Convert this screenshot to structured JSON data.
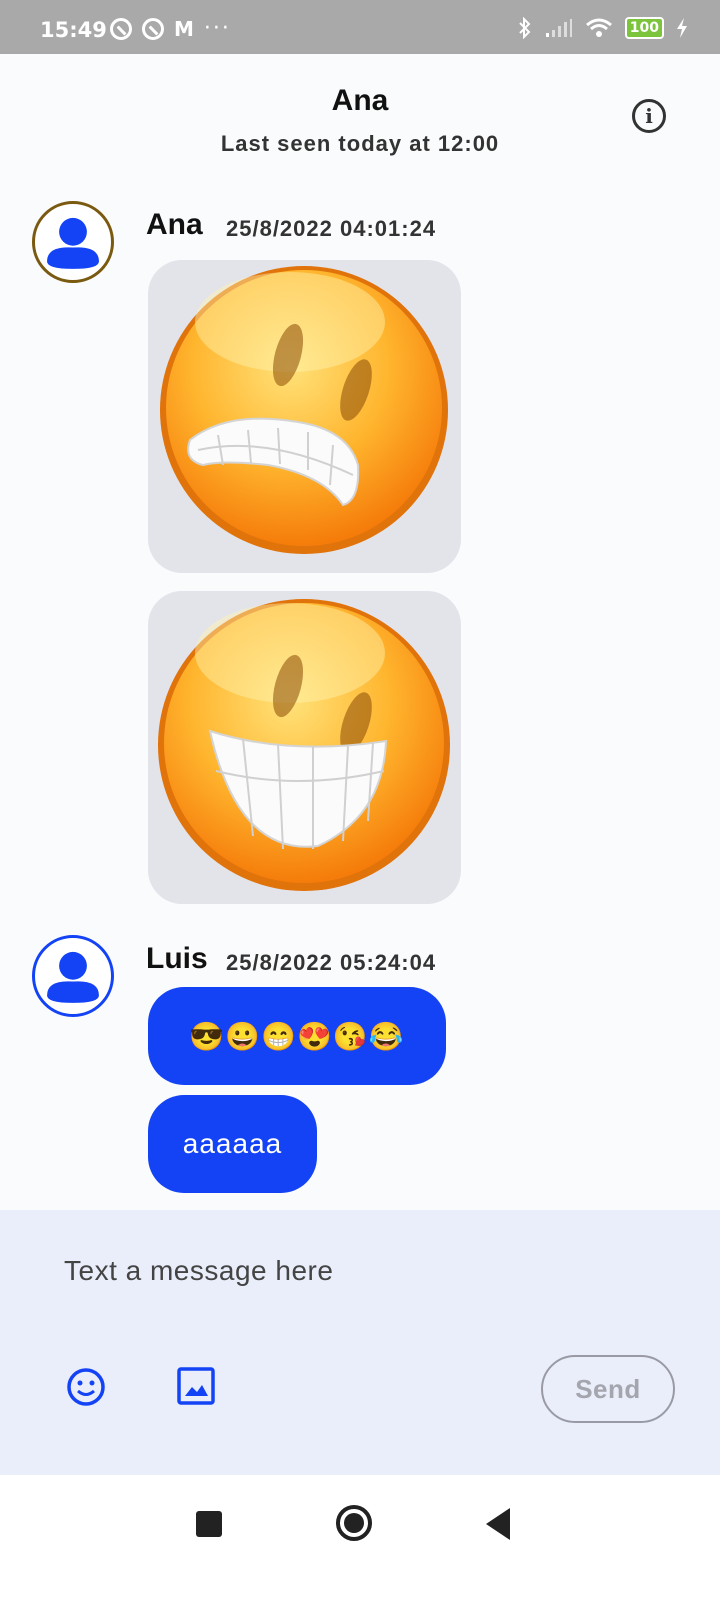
{
  "status_bar": {
    "time": "15:49",
    "battery": "100",
    "dots": "···"
  },
  "header": {
    "contact_name": "Ana",
    "last_seen": "Last seen today at 12:00"
  },
  "messages": [
    {
      "sender": "Ana",
      "timestamp": "25/8/2022 04:01:24",
      "avatar_color": "#7a5a10",
      "items": [
        "grimacing-smiley-image",
        "grinning-smiley-image"
      ]
    },
    {
      "sender": "Luis",
      "timestamp": "25/8/2022 05:24:04",
      "avatar_color": "#1443f5",
      "texts": [
        "😎😀😁😍😘😂",
        "aaaaaa"
      ]
    }
  ],
  "composer": {
    "placeholder": "Text a message here",
    "send_label": "Send"
  },
  "colors": {
    "accent": "#1443f5",
    "composer_bg": "#e9eefa",
    "status_bar": "#a9a9a9"
  }
}
